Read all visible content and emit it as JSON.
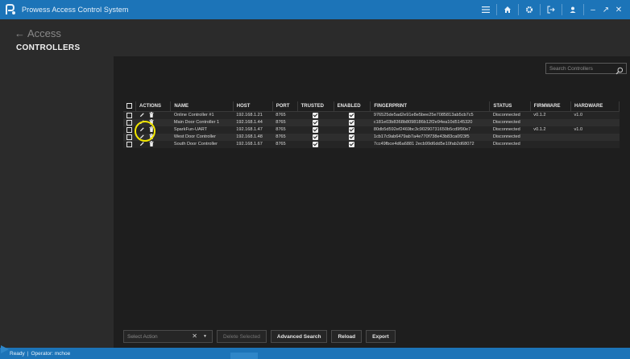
{
  "app": {
    "title": "Prowess Access Control System"
  },
  "header": {
    "back_label": "Access",
    "page_title": "CONTROLLERS"
  },
  "search": {
    "placeholder": "Search Controllers"
  },
  "table": {
    "columns": [
      "",
      "ACTIONS",
      "NAME",
      "HOST",
      "PORT",
      "TRUSTED",
      "ENABLED",
      "FINGERPRINT",
      "STATUS",
      "FIRMWARE",
      "HARDWARE"
    ],
    "rows": [
      {
        "name": "Online Controller #1",
        "host": "192.168.1.21",
        "port": "8765",
        "trusted": true,
        "enabled": true,
        "fingerprint": "976525de5ad2e91e8e5bee25e7085813ab5cb7c5",
        "status": "Disconnected",
        "firmware": "v0.1.2",
        "hardware": "v1.0"
      },
      {
        "name": "Main Door Controller 1",
        "host": "192.168.1.44",
        "port": "8765",
        "trusted": true,
        "enabled": true,
        "fingerprint": "c181e03b8368b8098186b12f2e94ea10d5145320",
        "status": "Disconnected",
        "firmware": "",
        "hardware": ""
      },
      {
        "name": "SparkFun-UART",
        "host": "192.168.1.47",
        "port": "8765",
        "trusted": true,
        "enabled": true,
        "fingerprint": "80db5d592ef2469bc3c90290731650b5cd9f90e7",
        "status": "Disconnected",
        "firmware": "v0.1.2",
        "hardware": "v1.0"
      },
      {
        "name": "West Door Controller",
        "host": "192.168.1.48",
        "port": "8765",
        "trusted": true,
        "enabled": true,
        "fingerprint": "1cb17c9ab6479ab7a4e770f738e43b83ca0f23f5",
        "status": "Disconnected",
        "firmware": "",
        "hardware": ""
      },
      {
        "name": "South Door Controller",
        "host": "192.168.1.67",
        "port": "8765",
        "trusted": true,
        "enabled": true,
        "fingerprint": "7cc49fbce4d6a6881 2ecb99d6dd5e10fab2d68072",
        "status": "Disconnected",
        "firmware": "",
        "hardware": ""
      }
    ]
  },
  "toolbar": {
    "select_action_placeholder": "Select Action",
    "delete_selected": "Delete Selected",
    "advanced_search": "Advanced Search",
    "reload": "Reload",
    "export": "Export"
  },
  "statusbar": {
    "state": "Ready",
    "operator": "Operator: mchoe"
  },
  "colors": {
    "accent": "#1c74b8",
    "highlight": "#f2e600"
  }
}
